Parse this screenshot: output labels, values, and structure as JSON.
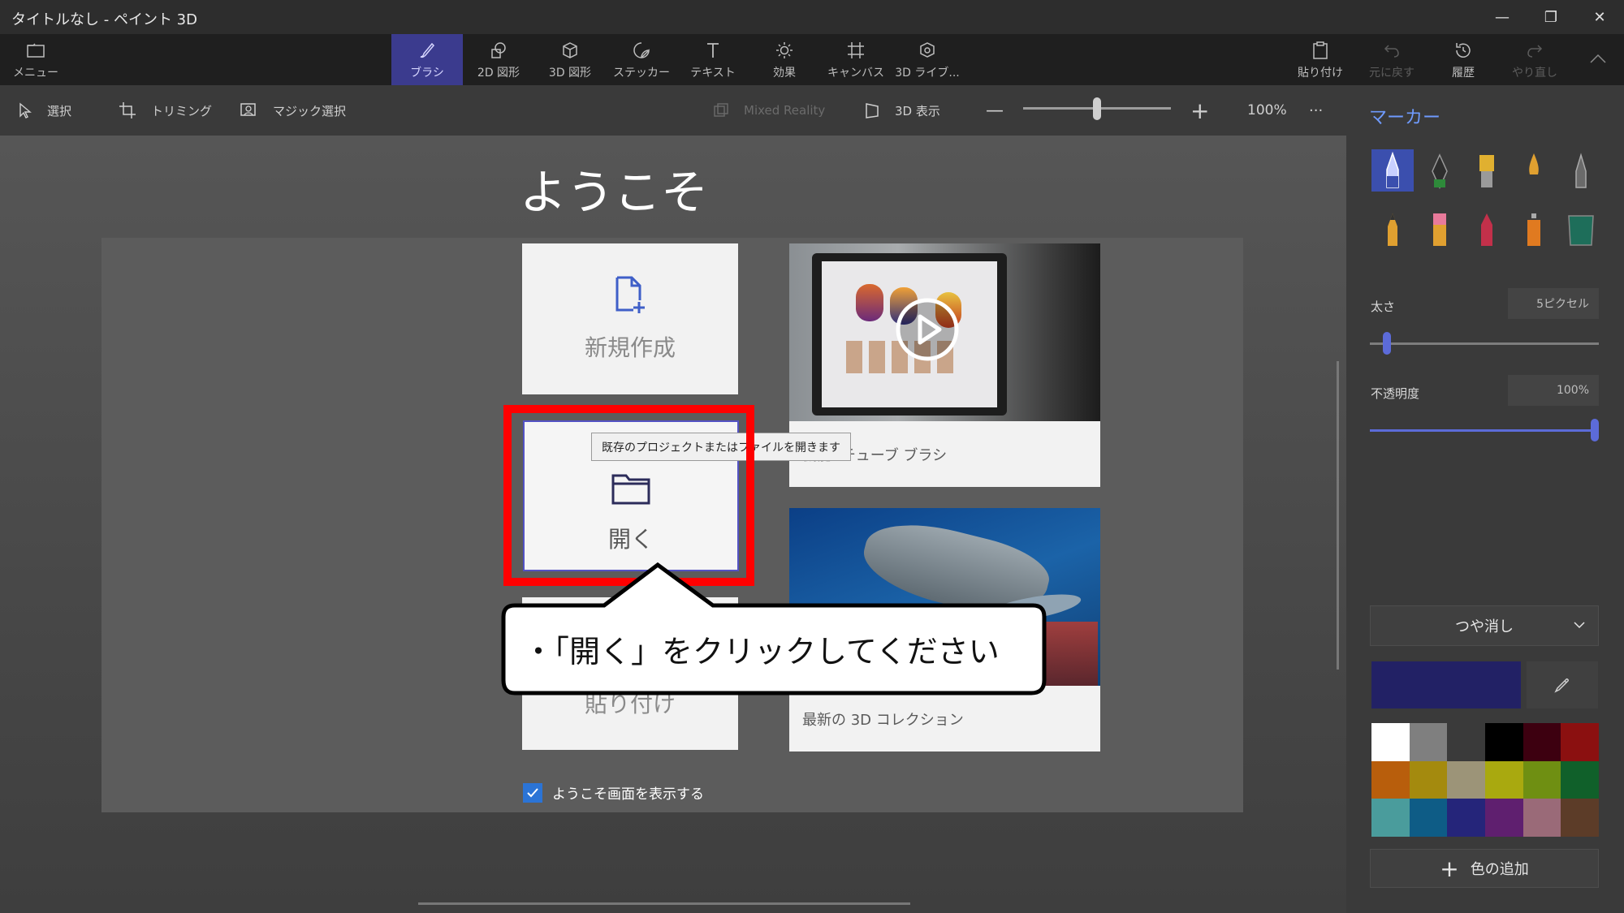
{
  "window": {
    "title": "タイトルなし - ペイント 3D",
    "controls": [
      "—",
      "❐",
      "✕"
    ]
  },
  "commandbar": {
    "menu": "メニュー",
    "tools": [
      {
        "label": "ブラシ",
        "icon": "brush-icon",
        "active": true
      },
      {
        "label": "2D 図形",
        "icon": "2d-shapes-icon"
      },
      {
        "label": "3D 図形",
        "icon": "3d-shapes-icon"
      },
      {
        "label": "ステッカー",
        "icon": "stickers-icon"
      },
      {
        "label": "テキスト",
        "icon": "text-icon"
      },
      {
        "label": "効果",
        "icon": "effects-icon"
      },
      {
        "label": "キャンバス",
        "icon": "canvas-icon"
      },
      {
        "label": "3D ライブ...",
        "icon": "3d-library-icon"
      }
    ],
    "paste": "貼り付け",
    "undo": "元に戻す",
    "history": "履歴",
    "redo": "やり直し"
  },
  "toolbar": {
    "select": "選択",
    "crop": "トリミング",
    "magic_select": "マジック選択",
    "mixed_reality": "Mixed Reality",
    "view_3d": "3D 表示",
    "zoom_minus": "—",
    "zoom_plus": "+",
    "zoom_level": "100%",
    "zoom_fraction": 0.5,
    "more": "···"
  },
  "welcome": {
    "title": "ようこそ",
    "new_label": "新規作成",
    "open_label": "開く",
    "paste_label": "貼り付け",
    "tooltip": "既存のプロジェクトまたはファイルを開きます",
    "feature_caption": "機能: チューブ ブラシ",
    "collection_caption": "最新の 3D コレクション",
    "show_welcome_label": "ようこそ画面を表示する",
    "show_welcome_checked": true,
    "callout_text": "・「開く」をクリックしてください"
  },
  "panel": {
    "title": "マーカー",
    "brushes": [
      "marker-icon",
      "calligraphy-pen-icon",
      "oil-brush-icon",
      "watercolor-icon",
      "pixel-pen-icon",
      "pencil-icon",
      "eraser-icon",
      "crayon-icon",
      "spray-can-icon",
      "fill-icon"
    ],
    "thickness_label": "太さ",
    "thickness_value": "5ピクセル",
    "thickness_fraction": 0.06,
    "opacity_label": "不透明度",
    "opacity_value": "100%",
    "opacity_fraction": 1.0,
    "finish": "つや消し",
    "add_color_label": "色の追加",
    "current_color": "#222165",
    "swatches": [
      "#ffffff",
      "#7f7f7f",
      "#3a3a3a",
      "#000000",
      "#3d0010",
      "#8b1010",
      "#b85e0c",
      "#a48a0e",
      "#9c9478",
      "#a9a90f",
      "#6f8f12",
      "#10602a",
      "#4a9c9c",
      "#0e5c86",
      "#25257a",
      "#5f1f6f",
      "#9a6a78",
      "#5c3c28"
    ]
  }
}
